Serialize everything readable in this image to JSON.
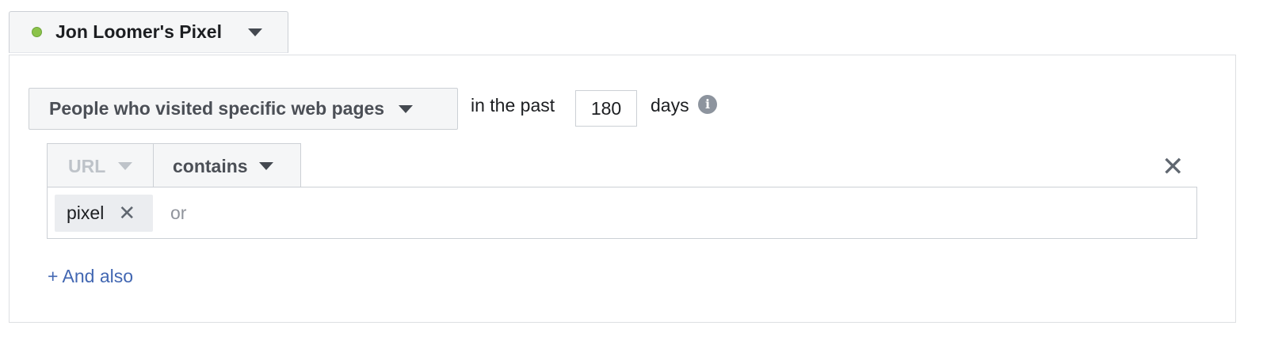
{
  "pixel": {
    "name": "Jon Loomer's Pixel",
    "status_color": "#8bc34a"
  },
  "rule": {
    "audience_type": "People who visited specific web pages",
    "in_past_label": "in the past",
    "days_value": "180",
    "days_label": "days",
    "info_icon": "i",
    "field": "URL",
    "operator": "contains",
    "remove_icon": "✕",
    "tokens": [
      "pixel"
    ],
    "token_remove_icon": "✕",
    "or_placeholder": "or",
    "and_also": "+ And also"
  },
  "colors": {
    "link": "#4267b2",
    "disabled_text": "#bec3c9"
  }
}
